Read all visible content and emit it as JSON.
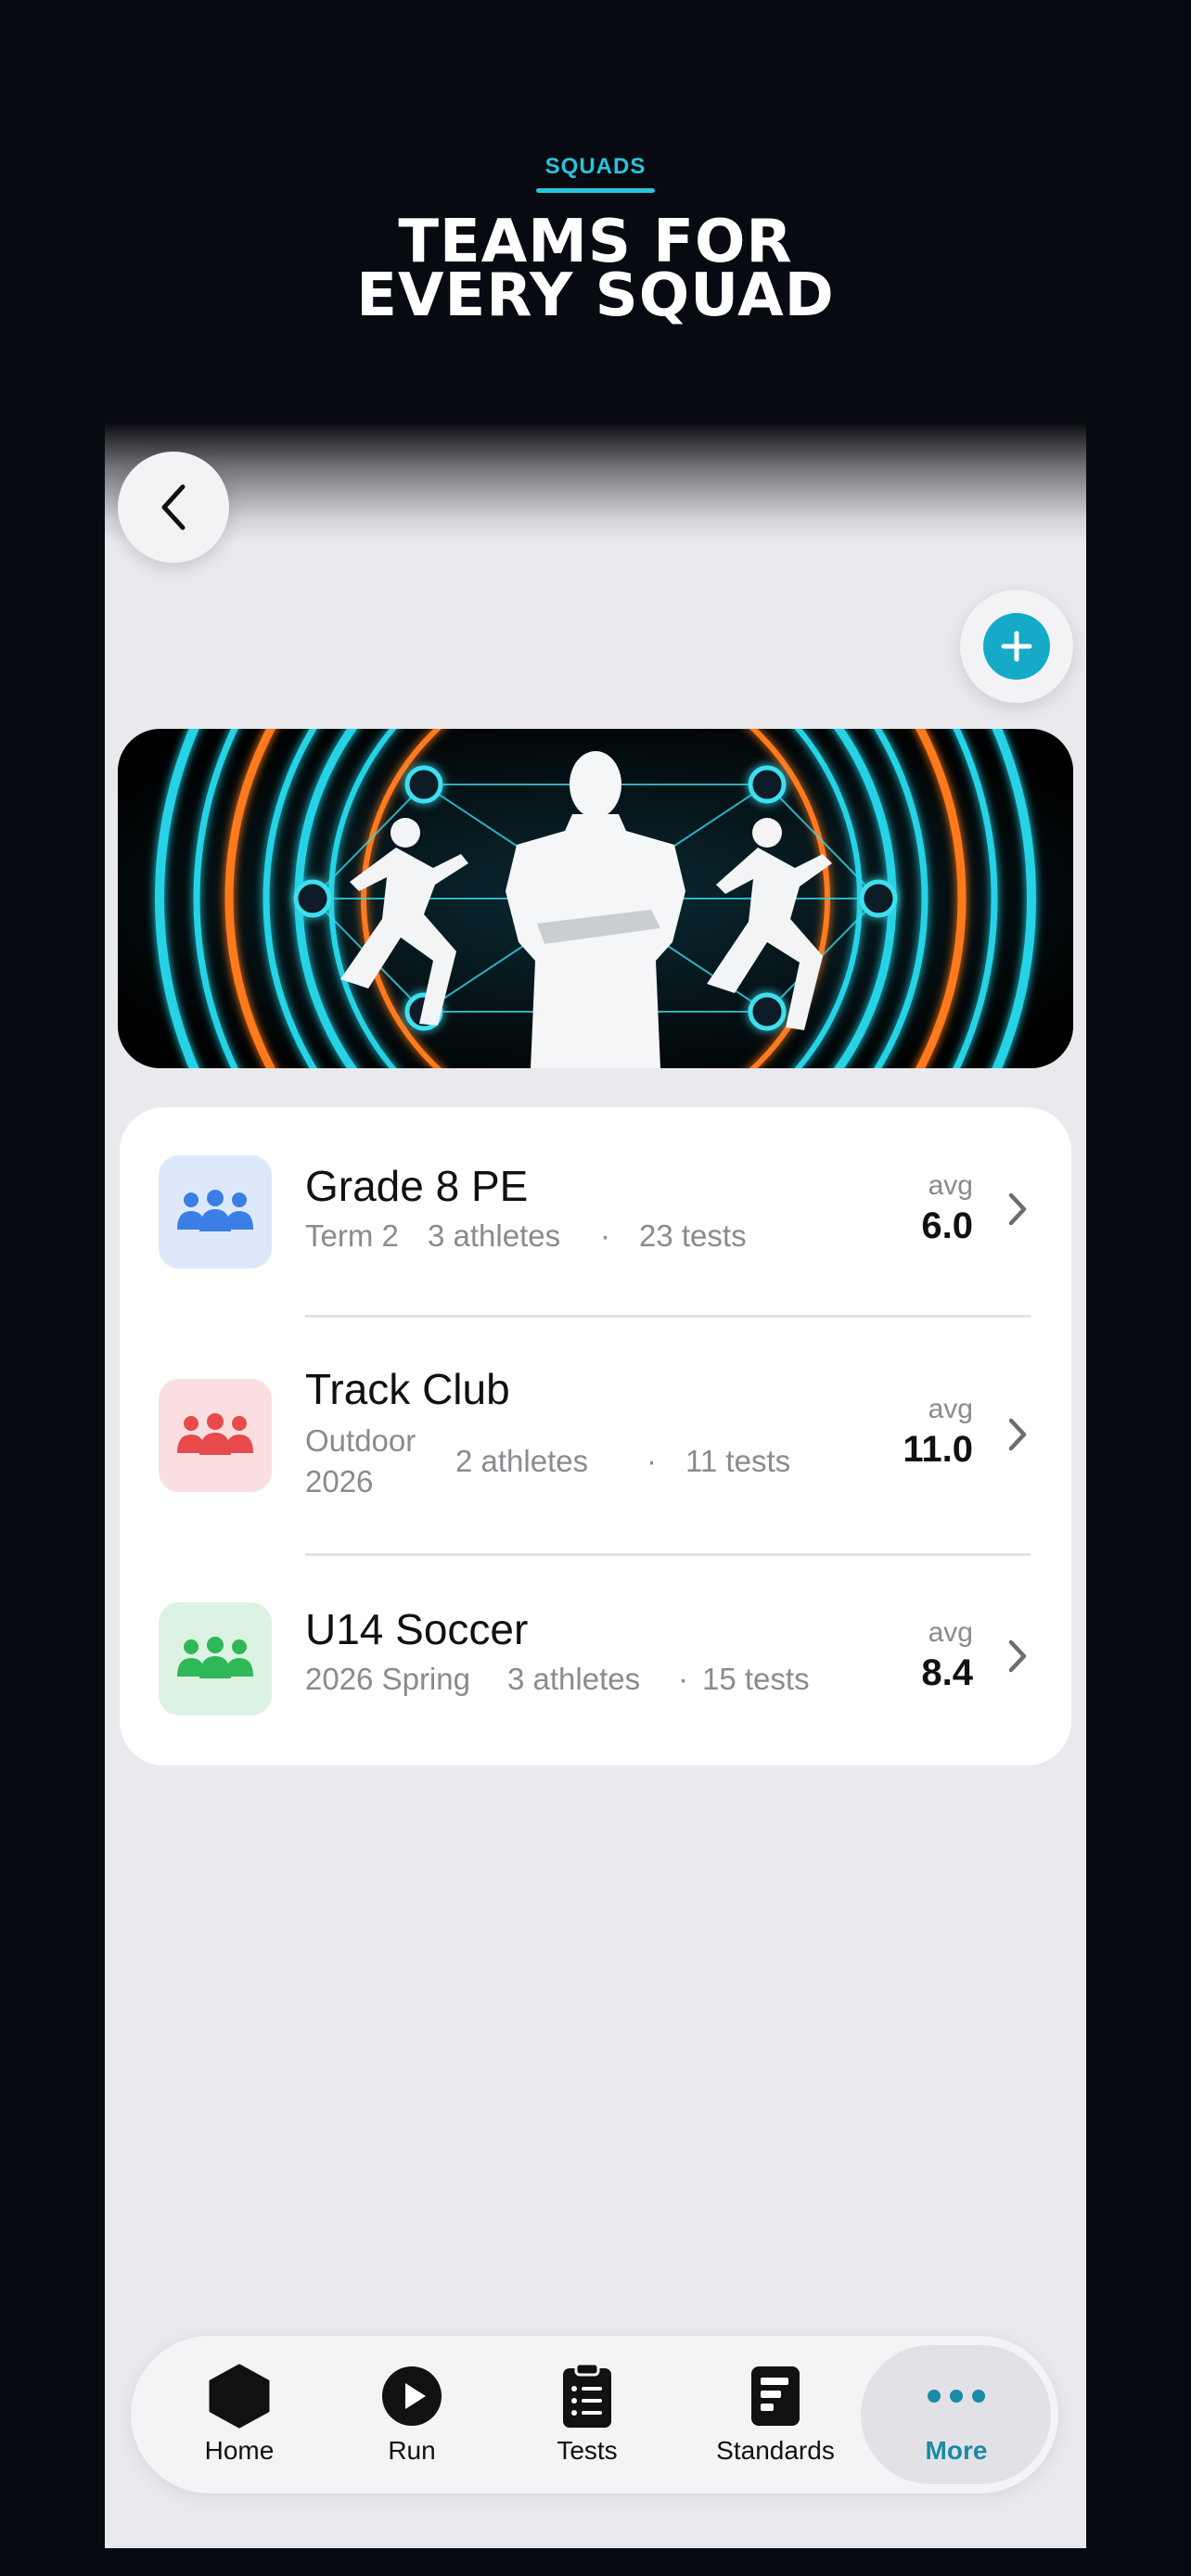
{
  "promo": {
    "label": "SQUADS",
    "title_line1": "TEAMS FOR",
    "title_line2": "EVERY SQUAD"
  },
  "colors": {
    "accent": "#15aac8",
    "promo_label": "#27c5dd",
    "active_tab": "#1a8aa6"
  },
  "teams": [
    {
      "name": "Grade 8 PE",
      "season": "Term 2",
      "athletes": "3 athletes",
      "separator": "·",
      "tests": "23 tests",
      "avg_label": "avg",
      "avg_value": "6.0",
      "icon": "people-group-icon",
      "icon_color": "#3b7fe6",
      "icon_bg": "#dde8fb"
    },
    {
      "name": "Track Club",
      "season_line1": "Outdoor",
      "season_line2": "2026",
      "athletes": "2 athletes",
      "separator": "·",
      "tests": "11 tests",
      "avg_label": "avg",
      "avg_value": "11.0",
      "icon": "people-group-icon",
      "icon_color": "#e8494a",
      "icon_bg": "#fbdfe0"
    },
    {
      "name": "U14 Soccer",
      "season": "2026 Spring",
      "athletes": "3 athletes",
      "separator": "·",
      "tests": "15 tests",
      "avg_label": "avg",
      "avg_value": "8.4",
      "icon": "people-group-icon",
      "icon_color": "#2fb857",
      "icon_bg": "#dcf3e3"
    }
  ],
  "tabs": [
    {
      "label": "Home",
      "icon": "hexagon-icon"
    },
    {
      "label": "Run",
      "icon": "play-circle-icon"
    },
    {
      "label": "Tests",
      "icon": "clipboard-list-icon"
    },
    {
      "label": "Standards",
      "icon": "document-bars-icon"
    },
    {
      "label": "More",
      "icon": "ellipsis-icon",
      "active": true
    }
  ]
}
